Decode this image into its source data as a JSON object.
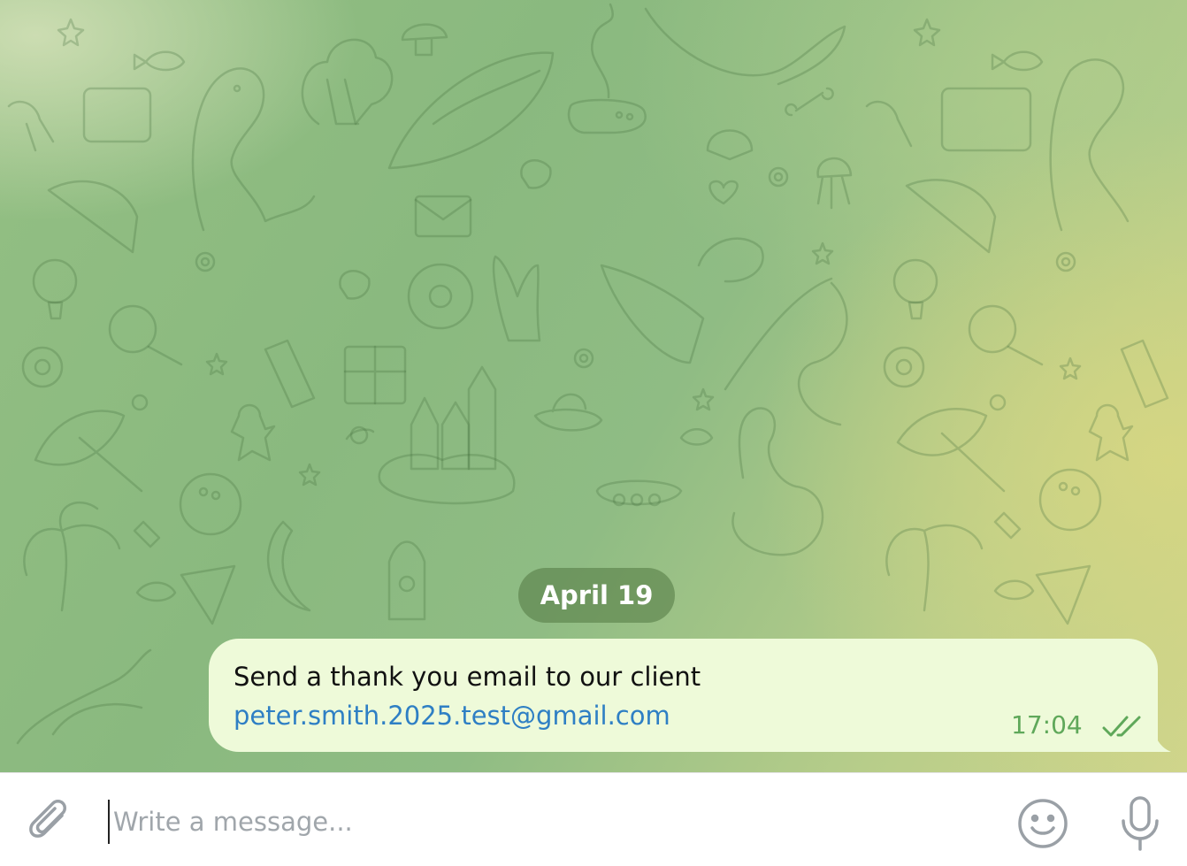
{
  "chat": {
    "date_separator": "April 19",
    "messages": [
      {
        "text": "Send a thank you email to our client",
        "link": "peter.smith.2025.test@gmail.com",
        "time": "17:04",
        "status_icon": "double-check-icon",
        "direction": "outgoing"
      }
    ]
  },
  "composer": {
    "placeholder": "Write a message...",
    "attach_icon": "paperclip-icon",
    "emoji_icon": "smiley-icon",
    "voice_icon": "microphone-icon"
  },
  "colors": {
    "bubble_bg": "#eefad9",
    "link": "#2e7fc4",
    "time": "#5fa85a",
    "date_pill": "#5a8048",
    "icon_gray": "#9aa0a6"
  }
}
